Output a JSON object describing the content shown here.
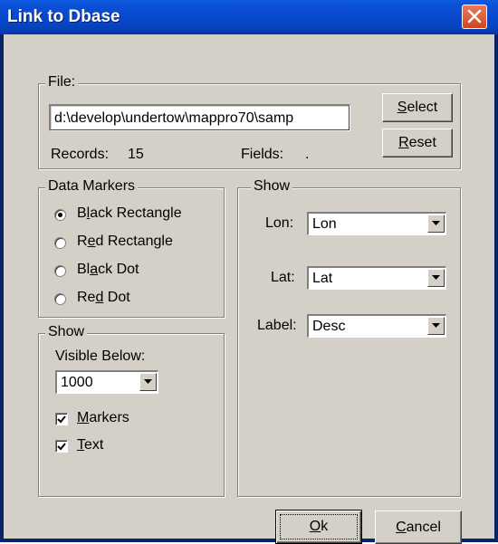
{
  "window": {
    "title": "Link to Dbase"
  },
  "file": {
    "legend": "File:",
    "path": "d:\\develop\\undertow\\mappro70\\samp",
    "records_label": "Records:",
    "records_value": "15",
    "fields_label": "Fields:",
    "fields_value": ".",
    "select_button": {
      "pre": "",
      "key": "S",
      "post": "elect"
    },
    "reset_button": {
      "pre": "",
      "key": "R",
      "post": "eset"
    }
  },
  "data_markers": {
    "legend": "Data Markers",
    "selected": "Black Rectangle",
    "options": [
      {
        "pre": "B",
        "key": "l",
        "post": "ack Rectangle"
      },
      {
        "pre": "R",
        "key": "e",
        "post": "d Rectangle"
      },
      {
        "pre": "Bl",
        "key": "a",
        "post": "ck Dot"
      },
      {
        "pre": "Re",
        "key": "d",
        "post": " Dot"
      }
    ]
  },
  "show_left": {
    "legend": "Show",
    "visible_below_label": "Visible Below:",
    "visible_below_value": "1000",
    "markers": {
      "pre": "",
      "key": "M",
      "post": "arkers",
      "checked": true
    },
    "text": {
      "pre": "",
      "key": "T",
      "post": "ext",
      "checked": true
    }
  },
  "show_right": {
    "legend": "Show",
    "lon_label": "Lon:",
    "lon_value": "Lon",
    "lat_label": "Lat:",
    "lat_value": "Lat",
    "label_label": "Label:",
    "label_value": "Desc"
  },
  "buttons": {
    "ok": {
      "pre": "",
      "key": "O",
      "post": "k"
    },
    "cancel": {
      "pre": "",
      "key": "C",
      "post": "ancel"
    }
  },
  "icons": {
    "close": "close-icon",
    "dropdown": "chevron-down-icon",
    "check": "check-icon"
  },
  "colors": {
    "titlebar": "#0a4fd6",
    "face": "#d4d0c8",
    "close": "#d2451e"
  }
}
